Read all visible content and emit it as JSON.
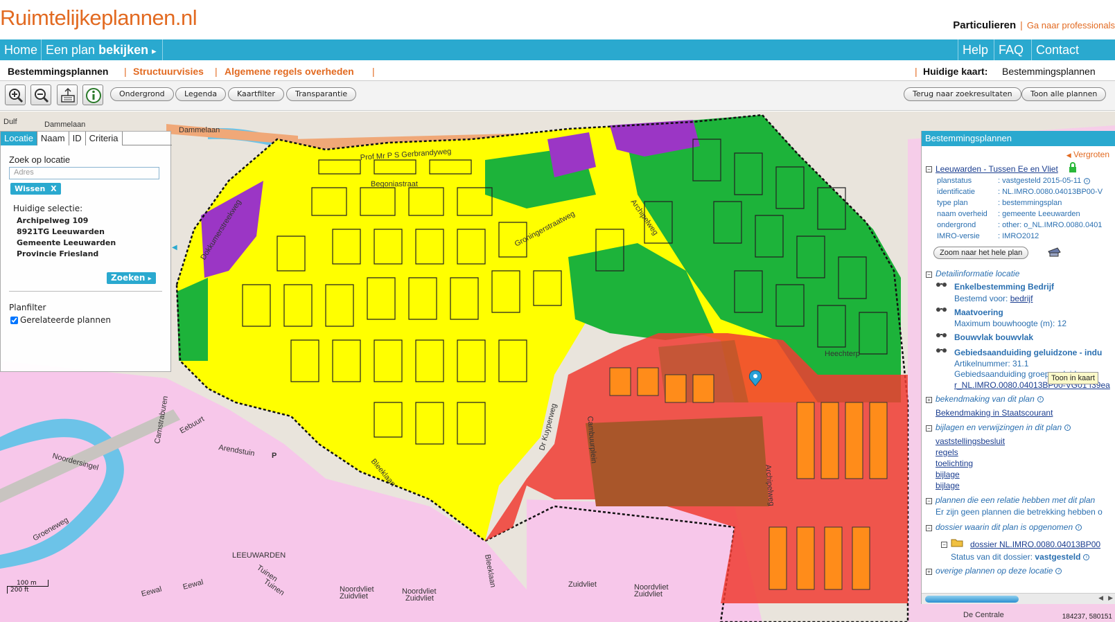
{
  "header": {
    "logo": "Ruimtelijkeplannen.nl",
    "audience_current": "Particulieren",
    "separator": "|",
    "audience_other": "Ga naar professionals"
  },
  "nav": {
    "home": "Home",
    "plan_prefix": "Een plan",
    "plan_bold": "bekijken",
    "plan_arrow": "▸",
    "help": "Help",
    "faq": "FAQ",
    "contact": "Contact"
  },
  "subnav": {
    "tab1": "Bestemmingsplannen",
    "tab2": "Structuurvisies",
    "tab3": "Algemene regels overheden",
    "sep": "|",
    "current_map_label": "Huidige kaart:",
    "current_map_value": "Bestemmingsplannen"
  },
  "toolbar": {
    "zoom_in_icon": "zoom-in-icon",
    "zoom_out_icon": "zoom-out-icon",
    "full_extent_icon": "full-extent-icon",
    "info_icon": "info-icon",
    "ondergrond": "Ondergrond",
    "legenda": "Legenda",
    "kaartfilter": "Kaartfilter",
    "transparantie": "Transparantie",
    "back": "Terug naar zoekresultaten",
    "show_all": "Toon alle plannen"
  },
  "left_panel": {
    "tabs": [
      "Locatie",
      "Naam",
      "ID",
      "Criteria"
    ],
    "search_label": "Zoek op locatie",
    "input_placeholder": "Adres",
    "clear_tag": "Wissen",
    "clear_x": "X",
    "selection_label": "Huidige selectie:",
    "address": [
      "Archipelweg 109",
      "8921TG Leeuwarden",
      "Gemeente Leeuwarden",
      "Provincie Friesland"
    ],
    "search_button": "Zoeken",
    "search_arrow": "▸",
    "planfilter_label": "Planfilter",
    "related_plans": "Gerelateerde plannen",
    "collapse_arrow": "◀"
  },
  "right_panel": {
    "title": "Bestemmingsplannen",
    "enlarge_arrow": "◀",
    "enlarge": "Vergroten",
    "plan_name": "Leeuwarden - Tussen Ee en Vliet",
    "props": [
      {
        "key": "planstatus",
        "value": ": vastgesteld 2015-05-11"
      },
      {
        "key": "identificatie",
        "value": ": NL.IMRO.0080.04013BP00-V"
      },
      {
        "key": "type plan",
        "value": ": bestemmingsplan"
      },
      {
        "key": "naam overheid",
        "value": ": gemeente Leeuwarden"
      },
      {
        "key": "ondergrond",
        "value": ": other: o_NL.IMRO.0080.0401"
      },
      {
        "key": "IMRO-versie",
        "value": ": IMRO2012"
      }
    ],
    "zoom_button": "Zoom naar het hele plan",
    "detail_header": "Detailinformatie locatie",
    "detail_items": [
      {
        "title": "Enkelbestemming Bedrijf",
        "sub_prefix": "Bestemd voor:",
        "sub_link": "bedrijf"
      },
      {
        "title": "Maatvoering",
        "sub_prefix": "Maximum bouwhoogte (m): 12",
        "sub_link": ""
      },
      {
        "title": "Bouwvlak bouwvlak",
        "sub_prefix": "",
        "sub_link": ""
      },
      {
        "title": "Gebiedsaanduiding geluidzone - indu",
        "sub_prefix": "Artikelnummer: 31.1",
        "sub_link": ""
      }
    ],
    "geb_group": "Gebiedsaanduiding groep: geluidzone",
    "geb_link": "r_NL.IMRO.0080.04013BP00-VG01 f39ea",
    "announce_header": "bekendmaking van dit plan",
    "announce_link": "Bekendmaking in Staatscourant",
    "attach_header": "bijlagen en verwijzingen in dit plan",
    "attachments": [
      "vaststellingsbesluit",
      "regels",
      "toelichting",
      "bijlage",
      "bijlage"
    ],
    "related_header": "plannen die een relatie hebben met dit plan",
    "related_text": "Er zijn geen plannen die betrekking hebben o",
    "dossier_header": "dossier waarin dit plan is opgenomen",
    "dossier_link": "dossier NL.IMRO.0080.04013BP00",
    "dossier_status_label": "Status van dit dossier:",
    "dossier_status": "vastgesteld",
    "other_header": "overige plannen op deze locatie",
    "tooltip": "Toon in kaart",
    "coords": "184237, 580151",
    "scroll_left": "◀",
    "scroll_right": "▶"
  },
  "map": {
    "scale_m": "100 m",
    "scale_ft": "200 ft",
    "street_labels": [
      "Dammelaan",
      "Dammelaan",
      "Dulf",
      "Prof Mr P S Gerbrandyweg",
      "Begoniastraat",
      "Dokkumerstreekweg",
      "Groningerstraatweg",
      "Archipelweg",
      "Archipelweg",
      "Camstraburen",
      "Eebuurt",
      "Arendstuin",
      "Noordersingel",
      "Groeneweg",
      "LEEUWARDEN",
      "Eewal",
      "Eewal",
      "Tuinen",
      "Tuinen",
      "Noordvliet",
      "Zuidvliet",
      "Noordvliet",
      "Zuidvliet",
      "Zuidvliet",
      "Noordvliet",
      "Zuidvliet",
      "Bleeklaan",
      "Bleeklaan",
      "Cambuurplein",
      "Heechterp",
      "Dr Kuyperweg",
      "P",
      "De Centrale"
    ]
  },
  "colors": {
    "accent": "#2aa9cf",
    "brand_orange": "#e26a21",
    "residential": "#ffff00",
    "green": "#1db33a",
    "business": "#9b36c5",
    "zone_red": "#f03c32"
  }
}
